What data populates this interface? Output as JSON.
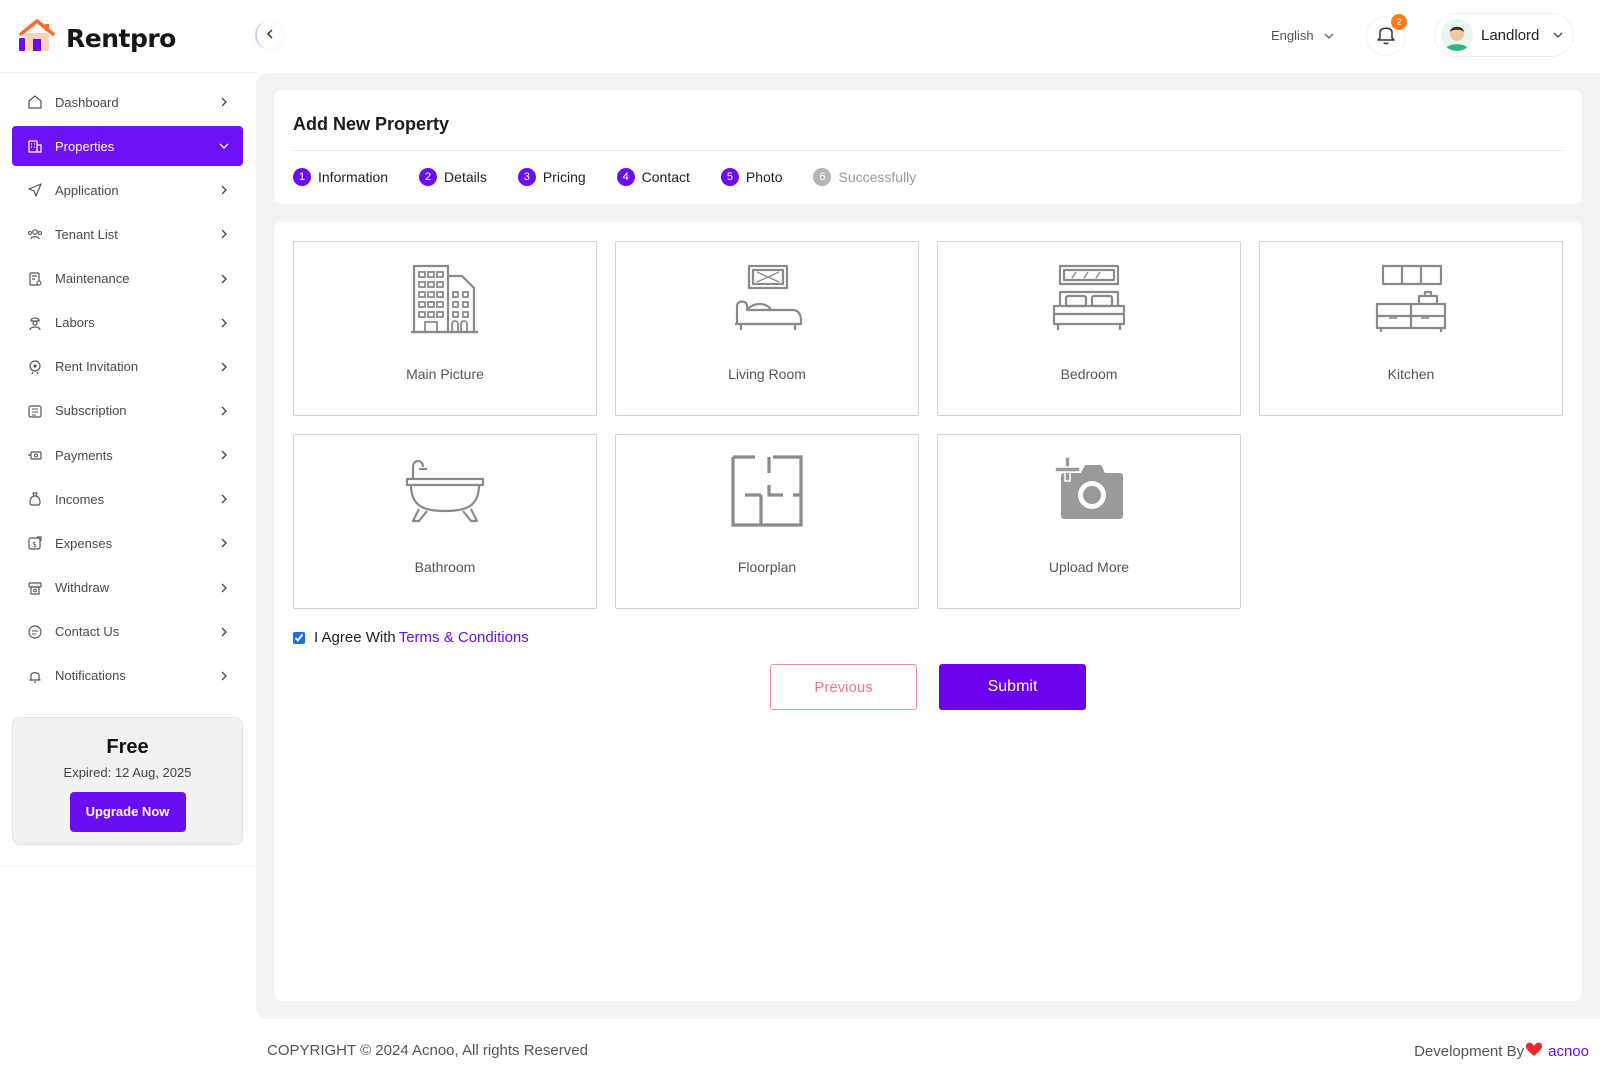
{
  "app": {
    "name": "Rentpro"
  },
  "sidebar": {
    "items": [
      {
        "label": "Dashboard",
        "icon": "home-icon"
      },
      {
        "label": "Properties",
        "icon": "building-icon",
        "active": true
      },
      {
        "label": "Application",
        "icon": "send-icon"
      },
      {
        "label": "Tenant List",
        "icon": "users-icon"
      },
      {
        "label": "Maintenance",
        "icon": "clipboard-icon"
      },
      {
        "label": "Labors",
        "icon": "worker-icon"
      },
      {
        "label": "Rent Invitation",
        "icon": "invitation-icon"
      },
      {
        "label": "Subscription",
        "icon": "subscription-icon"
      },
      {
        "label": "Payments",
        "icon": "payments-icon"
      },
      {
        "label": "Incomes",
        "icon": "money-bag-icon"
      },
      {
        "label": "Expenses",
        "icon": "expenses-icon"
      },
      {
        "label": "Withdraw",
        "icon": "withdraw-icon"
      },
      {
        "label": "Contact Us",
        "icon": "chat-icon"
      },
      {
        "label": "Notifications",
        "icon": "bell-icon"
      }
    ],
    "plan": {
      "name": "Free",
      "expiry": "Expired: 12 Aug, 2025",
      "upgrade_label": "Upgrade Now"
    }
  },
  "topbar": {
    "language": "English",
    "notification_count": "2",
    "user_name": "Landlord"
  },
  "page": {
    "title": "Add New Property",
    "steps": [
      {
        "num": "1",
        "label": "Information",
        "state": "done"
      },
      {
        "num": "2",
        "label": "Details",
        "state": "done"
      },
      {
        "num": "3",
        "label": "Pricing",
        "state": "done"
      },
      {
        "num": "4",
        "label": "Contact",
        "state": "done"
      },
      {
        "num": "5",
        "label": "Photo",
        "state": "current"
      },
      {
        "num": "6",
        "label": "Successfully",
        "state": "pending"
      }
    ],
    "tiles": [
      {
        "label": "Main Picture",
        "icon": "building-icon"
      },
      {
        "label": "Living Room",
        "icon": "sofa-icon"
      },
      {
        "label": "Bedroom",
        "icon": "bed-icon"
      },
      {
        "label": "Kitchen",
        "icon": "kitchen-icon"
      },
      {
        "label": "Bathroom",
        "icon": "bathtub-icon"
      },
      {
        "label": "Floorplan",
        "icon": "floorplan-icon"
      },
      {
        "label": "Upload More",
        "icon": "add-camera-icon"
      }
    ],
    "agree_text": "I Agree With",
    "terms_link": "Terms & Conditions",
    "previous_label": "Previous",
    "submit_label": "Submit"
  },
  "footer": {
    "copyright": "COPYRIGHT © 2024 Acnoo, All rights Reserved",
    "dev_by": "Development By",
    "dev_brand": "acnoo"
  },
  "colors": {
    "accent": "#6a0df0",
    "badge": "#ff7a1a",
    "previous_border": "#f28aa6"
  }
}
